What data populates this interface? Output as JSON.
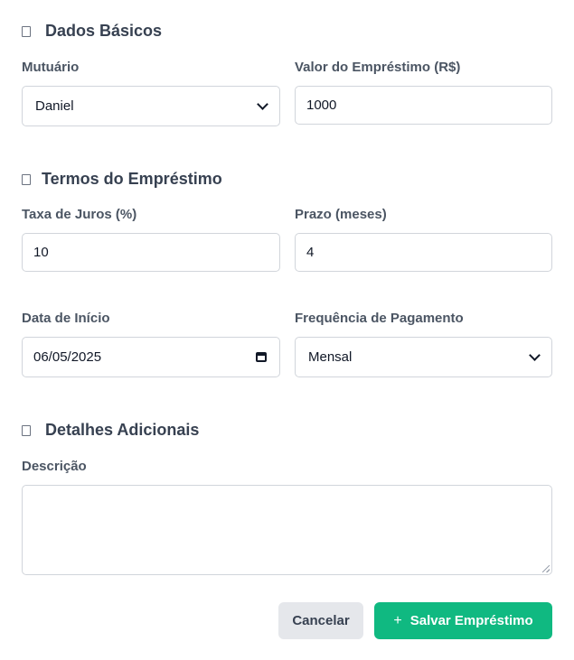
{
  "sections": {
    "basic": {
      "title": "Dados Básicos"
    },
    "terms": {
      "title": "Termos do Empréstimo"
    },
    "details": {
      "title": "Detalhes Adicionais"
    }
  },
  "fields": {
    "borrower": {
      "label": "Mutuário",
      "value": "Daniel"
    },
    "amount": {
      "label": "Valor do Empréstimo (R$)",
      "value": "1000"
    },
    "interest_rate": {
      "label": "Taxa de Juros (%)",
      "value": "10"
    },
    "term": {
      "label": "Prazo (meses)",
      "value": "4"
    },
    "start_date": {
      "label": "Data de Início",
      "value": "06/05/2025"
    },
    "frequency": {
      "label": "Frequência de Pagamento",
      "value": "Mensal"
    },
    "description": {
      "label": "Descrição",
      "value": ""
    }
  },
  "actions": {
    "cancel_label": "Cancelar",
    "save_label": "Salvar Empréstimo",
    "save_icon": "+"
  },
  "colors": {
    "primary": "#10b981",
    "secondary_bg": "#e5e7eb"
  }
}
